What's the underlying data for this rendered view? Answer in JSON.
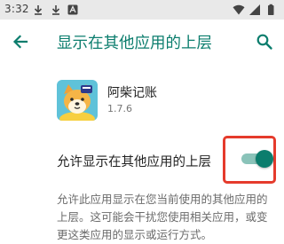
{
  "status_bar": {
    "time": "3:32",
    "icons": [
      "download-icon",
      "download-icon",
      "app-notification-icon",
      "wifi-icon",
      "signal-icon",
      "battery-icon"
    ]
  },
  "app_bar": {
    "back_icon": "arrow-left-icon",
    "title": "显示在其他应用的上层",
    "search_icon": "search-icon"
  },
  "app_info": {
    "name": "阿柴记账",
    "version": "1.7.6"
  },
  "permission": {
    "label": "允许显示在其他应用的上层",
    "enabled": true
  },
  "description": "允许此应用显示在您当前使用的其他应用的上层。这可能会干扰您使用相关应用，或变更这类应用的显示或运行方式。",
  "colors": {
    "accent": "#0b7d6d",
    "switch_track": "#8ac3b9",
    "highlight": "#e53b2c",
    "status_bar_bg": "#e9e9e9"
  }
}
